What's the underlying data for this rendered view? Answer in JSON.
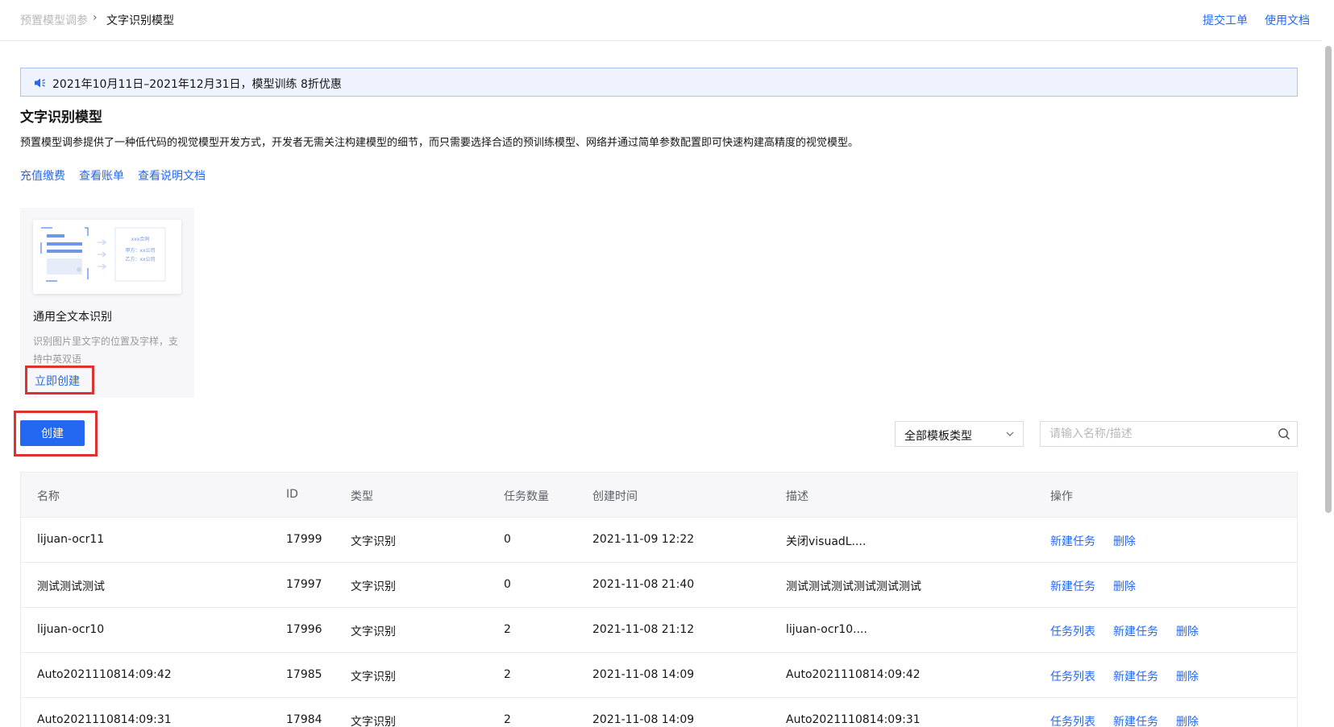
{
  "breadcrumb": {
    "parent": "预置模型调参",
    "current": "文字识别模型"
  },
  "header_links": {
    "ticket": "提交工单",
    "docs": "使用文档"
  },
  "notice": {
    "text": "2021年10月11日–2021年12月31日，模型训练 8折优惠",
    "icon": "speaker-icon"
  },
  "page": {
    "title": "文字识别模型",
    "description": "预置模型调参提供了一种低代码的视觉模型开发方式，开发者无需关注构建模型的细节，而只需要选择合适的预训练模型、网络并通过简单参数配置即可快速构建高精度的视觉模型。",
    "links": [
      "充值缴费",
      "查看账单",
      "查看说明文档"
    ]
  },
  "template_card": {
    "name": "通用全文本识别",
    "description": "识别图片里文字的位置及字样，支持中英双语",
    "create_label": "立即创建",
    "illustration": {
      "line1": "xxx合同",
      "line2": "甲方：xx公司",
      "line3": "乙方：xx公司"
    }
  },
  "toolbar": {
    "create_label": "创建",
    "type_filter": "全部模板类型",
    "search_placeholder": "请输入名称/描述"
  },
  "table": {
    "columns": [
      "名称",
      "ID",
      "类型",
      "任务数量",
      "创建时间",
      "描述",
      "操作"
    ],
    "rows": [
      {
        "name": "lijuan-ocr11",
        "id": "17999",
        "type": "文字识别",
        "tasks": "0",
        "created": "2021-11-09 12:22",
        "desc": "关闭visuadL....",
        "ops": [
          "新建任务",
          "删除"
        ]
      },
      {
        "name": "测试测试测试",
        "id": "17997",
        "type": "文字识别",
        "tasks": "0",
        "created": "2021-11-08 21:40",
        "desc": "测试测试测试测试测试测试",
        "ops": [
          "新建任务",
          "删除"
        ]
      },
      {
        "name": "lijuan-ocr10",
        "id": "17996",
        "type": "文字识别",
        "tasks": "2",
        "created": "2021-11-08 21:12",
        "desc": "lijuan-ocr10....",
        "ops": [
          "任务列表",
          "新建任务",
          "删除"
        ]
      },
      {
        "name": "Auto2021110814:09:42",
        "id": "17985",
        "type": "文字识别",
        "tasks": "2",
        "created": "2021-11-08 14:09",
        "desc": "Auto2021110814:09:42",
        "ops": [
          "任务列表",
          "新建任务",
          "删除"
        ]
      },
      {
        "name": "Auto2021110814:09:31",
        "id": "17984",
        "type": "文字识别",
        "tasks": "2",
        "created": "2021-11-08 14:09",
        "desc": "Auto2021110814:09:31",
        "ops": [
          "任务列表",
          "新建任务",
          "删除"
        ]
      }
    ]
  },
  "colors": {
    "accent": "#2468f2",
    "highlight": "#e03131"
  }
}
